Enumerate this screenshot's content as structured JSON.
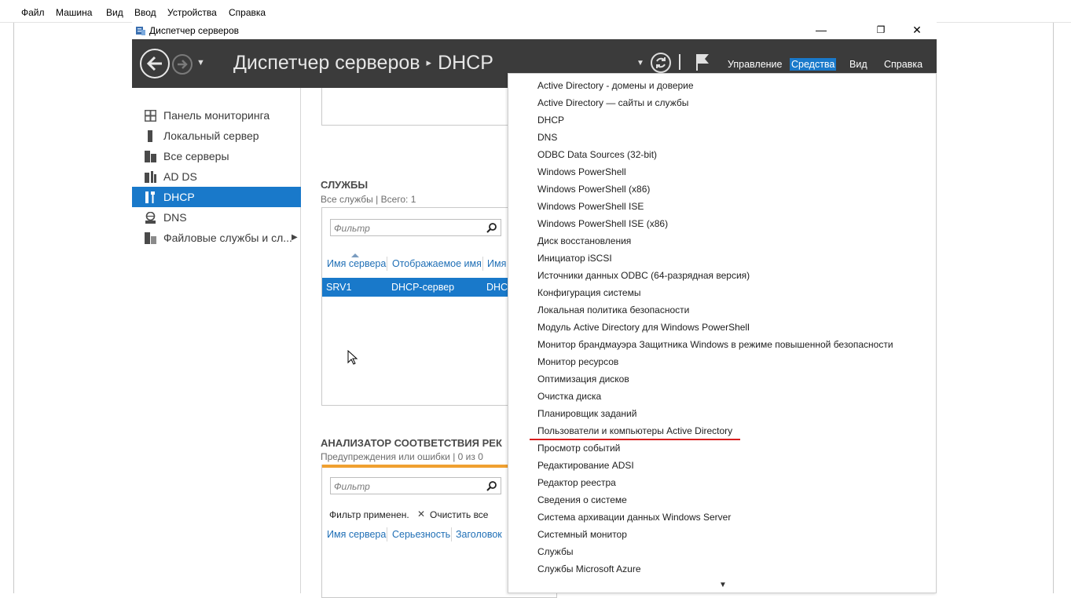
{
  "host_menu": {
    "items": [
      "Файл",
      "Машина",
      "Вид",
      "Ввод",
      "Устройства",
      "Справка"
    ]
  },
  "window": {
    "title": "Диспетчер серверов",
    "controls": {
      "minimize": "—",
      "restore": "❐",
      "close": "✕"
    }
  },
  "header": {
    "breadcrumb_root": "Диспетчер серверов",
    "breadcrumb_sep": "▸",
    "breadcrumb_current": "DHCP",
    "menu": [
      "Управление",
      "Средства",
      "Вид",
      "Справка"
    ],
    "active_menu": "Средства"
  },
  "sidebar": {
    "items": [
      {
        "label": "Панель мониторинга",
        "icon": "dashboard-icon"
      },
      {
        "label": "Локальный сервер",
        "icon": "server-icon"
      },
      {
        "label": "Все серверы",
        "icon": "servers-icon"
      },
      {
        "label": "AD DS",
        "icon": "ad-ds-icon"
      },
      {
        "label": "DHCP",
        "icon": "dhcp-icon",
        "selected": true
      },
      {
        "label": "DNS",
        "icon": "dns-icon"
      },
      {
        "label": "Файловые службы и сл...",
        "icon": "file-services-icon",
        "has_submenu": true
      }
    ]
  },
  "services": {
    "title": "СЛУЖБЫ",
    "subtitle": "Все службы | Всего: 1",
    "filter_placeholder": "Фильтр",
    "columns": [
      "Имя сервера",
      "Отображаемое имя",
      "Имя"
    ],
    "rows": [
      {
        "server": "SRV1",
        "display_name": "DHCP-сервер",
        "name": "DHC"
      }
    ]
  },
  "bpa": {
    "title": "АНАЛИЗАТОР СООТВЕТСТВИЯ РЕК",
    "subtitle": "Предупреждения или ошибки | 0 из 0",
    "filter_placeholder": "Фильтр",
    "filter_applied": "Фильтр применен.",
    "clear_all": "Очистить все",
    "clear_icon": "✕",
    "columns": [
      "Имя сервера",
      "Серьезность",
      "Заголовок"
    ]
  },
  "tools_menu": {
    "items": [
      "Active Directory - домены и доверие",
      "Active Directory — сайты и службы",
      "DHCP",
      "DNS",
      "ODBC Data Sources (32-bit)",
      "Windows PowerShell",
      "Windows PowerShell (x86)",
      "Windows PowerShell ISE",
      "Windows PowerShell ISE (x86)",
      "Диск восстановления",
      "Инициатор iSCSI",
      "Источники данных ODBC (64-разрядная версия)",
      "Конфигурация системы",
      "Локальная политика безопасности",
      "Модуль Active Directory для Windows PowerShell",
      "Монитор брандмауэра Защитника Windows в режиме повышенной безопасности",
      "Монитор ресурсов",
      "Оптимизация дисков",
      "Очистка диска",
      "Планировщик заданий",
      "Пользователи и компьютеры Active Directory",
      "Просмотр событий",
      "Редактирование ADSI",
      "Редактор реестра",
      "Сведения о системе",
      "Система архивации данных Windows Server",
      "Системный монитор",
      "Службы",
      "Службы Microsoft Azure"
    ],
    "highlighted": "Пользователи и компьютеры Active Directory",
    "scroll_indicator": "▼"
  },
  "colors": {
    "header_bg": "#3b3b3b",
    "accent": "#1979ca",
    "link": "#1f6fb6",
    "annotation_red": "#d81e1e",
    "bpa_bar": "#f0a030"
  }
}
